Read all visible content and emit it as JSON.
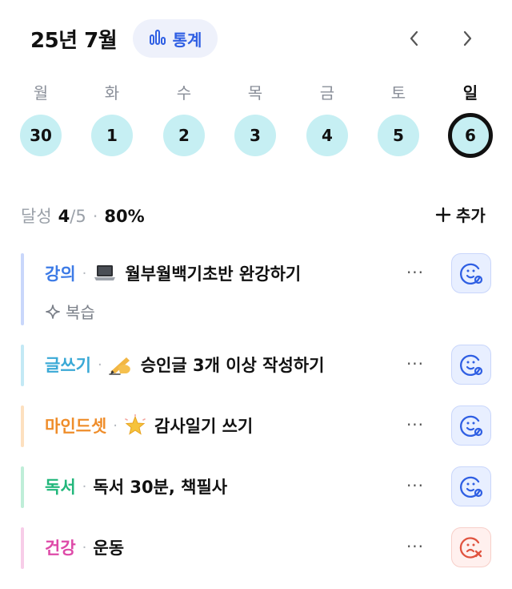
{
  "header": {
    "month": "25년 7월",
    "stats_label": "통계",
    "accent": "#2f5fe3"
  },
  "week": {
    "weekdays": [
      "월",
      "화",
      "수",
      "목",
      "금",
      "토",
      "일"
    ],
    "days": [
      "30",
      "1",
      "2",
      "3",
      "4",
      "5",
      "6"
    ],
    "selected_index": 6,
    "day_bg": "#c6eff3"
  },
  "summary": {
    "label": "달성",
    "done": "4",
    "total": "/5",
    "percent": "80%",
    "add_label": "추가"
  },
  "habits": [
    {
      "category": "강의",
      "category_color": "#3d7be6",
      "bar_color": "#c9d7fb",
      "emoji": "laptop",
      "name": "월부월백기초반 완강하기",
      "sub": "복습",
      "status": "ok"
    },
    {
      "category": "글쓰기",
      "category_color": "#3aa9d6",
      "bar_color": "#c3e9f5",
      "emoji": "writing-hand",
      "name": "승인글 3개 이상 작성하기",
      "status": "ok"
    },
    {
      "category": "마인드셋",
      "category_color": "#ef8d2a",
      "bar_color": "#fde0bf",
      "emoji": "glowing-star",
      "name": "감사일기 쓰기",
      "status": "ok"
    },
    {
      "category": "독서",
      "category_color": "#22b77b",
      "bar_color": "#bfeed8",
      "emoji": "",
      "name": "독서 30분, 책필사",
      "status": "ok"
    },
    {
      "category": "건강",
      "category_color": "#de4aa8",
      "bar_color": "#f7cde8",
      "emoji": "",
      "name": "운동",
      "status": "fail"
    }
  ],
  "more_label": "···"
}
